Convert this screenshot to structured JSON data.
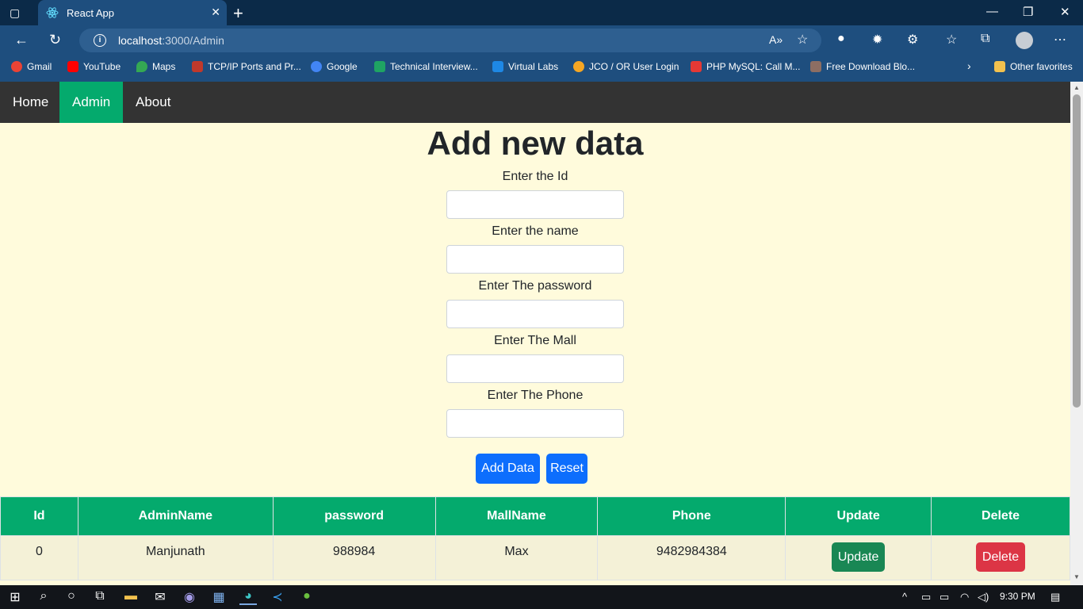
{
  "browser": {
    "tab_title": "React App",
    "url_host": "localhost",
    "url_path": ":3000/Admin",
    "favorites": [
      {
        "label": "Gmail",
        "color": "#ea4335"
      },
      {
        "label": "YouTube",
        "color": "#ff0000"
      },
      {
        "label": "Maps",
        "color": "#34a853"
      },
      {
        "label": "TCP/IP Ports and Pr...",
        "color": "#c0392b"
      },
      {
        "label": "Google",
        "color": "#4285f4"
      },
      {
        "label": "Technical Interview...",
        "color": "#1fa463"
      },
      {
        "label": "Virtual Labs",
        "color": "#1e88e5"
      },
      {
        "label": "JCO / OR User Login",
        "color": "#f5a623"
      },
      {
        "label": "PHP MySQL: Call M...",
        "color": "#e53935"
      },
      {
        "label": "Free Download Blo...",
        "color": "#8d6e63"
      }
    ],
    "other_favorites": "Other favorites"
  },
  "nav": {
    "home": "Home",
    "admin": "Admin",
    "about": "About"
  },
  "form": {
    "heading": "Add new data",
    "id_label": "Enter the Id",
    "name_label": "Enter the name",
    "password_label": "Enter The password",
    "mall_label": "Enter The Mall",
    "phone_label": "Enter The Phone",
    "add_button": "Add Data",
    "reset_button": "Reset"
  },
  "table": {
    "headers": [
      "Id",
      "AdminName",
      "password",
      "MallName",
      "Phone",
      "Update",
      "Delete"
    ],
    "rows": [
      {
        "id": "0",
        "admin_name": "Manjunath",
        "password": "988984",
        "mall_name": "Max",
        "phone": "9482984384",
        "update_label": "Update",
        "delete_label": "Delete"
      }
    ]
  },
  "taskbar": {
    "time": "9:30 PM"
  },
  "colors": {
    "nav_active": "#04aa6d",
    "table_header": "#04aa6d",
    "page_bg": "#fffbdc",
    "primary": "#0d6efd",
    "success": "#198754",
    "danger": "#dc3545"
  }
}
